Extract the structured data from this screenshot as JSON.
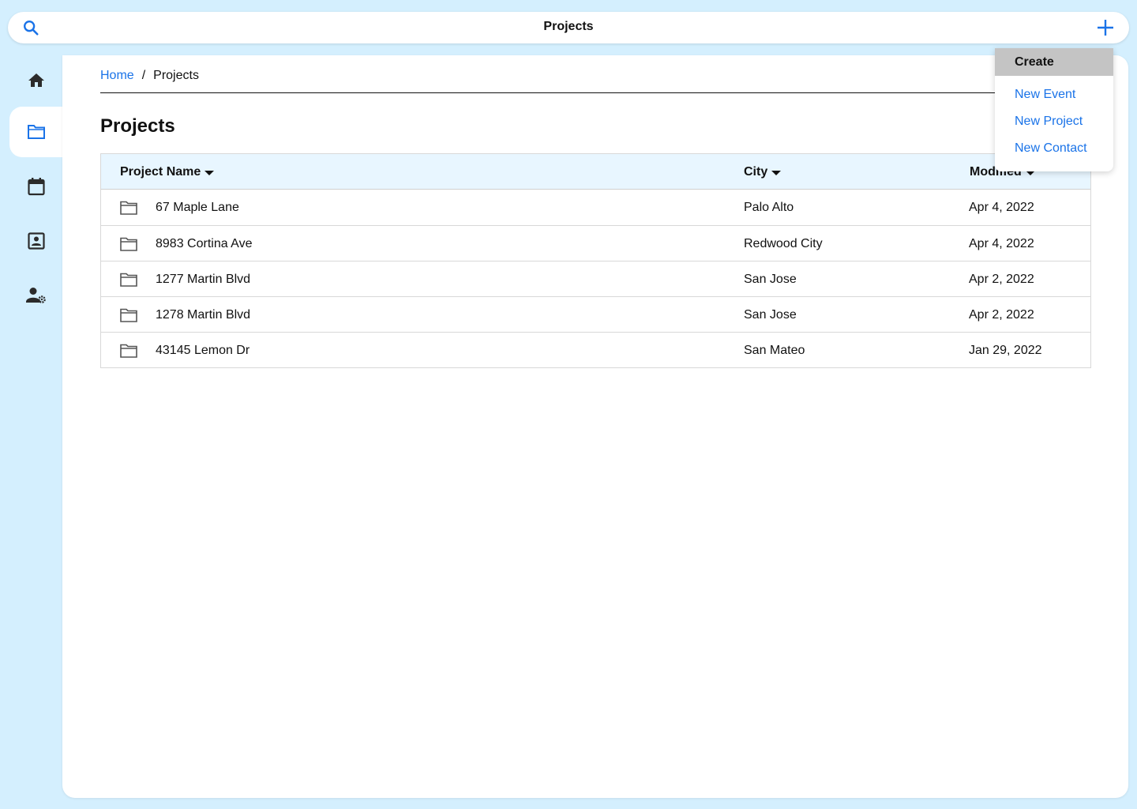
{
  "header": {
    "title": "Projects"
  },
  "nav": {
    "items": [
      {
        "name": "home",
        "icon": "home-icon"
      },
      {
        "name": "projects",
        "icon": "folder-icon",
        "active": true
      },
      {
        "name": "calendar",
        "icon": "calendar-icon"
      },
      {
        "name": "contacts",
        "icon": "contact-card-icon"
      },
      {
        "name": "user-settings",
        "icon": "user-settings-icon"
      }
    ]
  },
  "breadcrumb": {
    "home": "Home",
    "separator": "/",
    "current": "Projects"
  },
  "page": {
    "title": "Projects"
  },
  "table": {
    "columns": [
      "Project Name",
      "City",
      "Modified"
    ],
    "rows": [
      {
        "name": "67 Maple Lane",
        "city": "Palo Alto",
        "modified": "Apr 4, 2022"
      },
      {
        "name": "8983 Cortina Ave",
        "city": "Redwood City",
        "modified": "Apr 4, 2022"
      },
      {
        "name": "1277 Martin Blvd",
        "city": "San Jose",
        "modified": "Apr 2, 2022"
      },
      {
        "name": "1278 Martin Blvd",
        "city": "San Jose",
        "modified": "Apr 2, 2022"
      },
      {
        "name": "43145 Lemon Dr",
        "city": "San Mateo",
        "modified": "Jan 29, 2022"
      }
    ]
  },
  "create_menu": {
    "header": "Create",
    "items": [
      "New Event",
      "New Project",
      "New Contact"
    ]
  },
  "colors": {
    "accent": "#1a73e8",
    "background": "#d4effe",
    "header_row": "#e8f6ff"
  }
}
